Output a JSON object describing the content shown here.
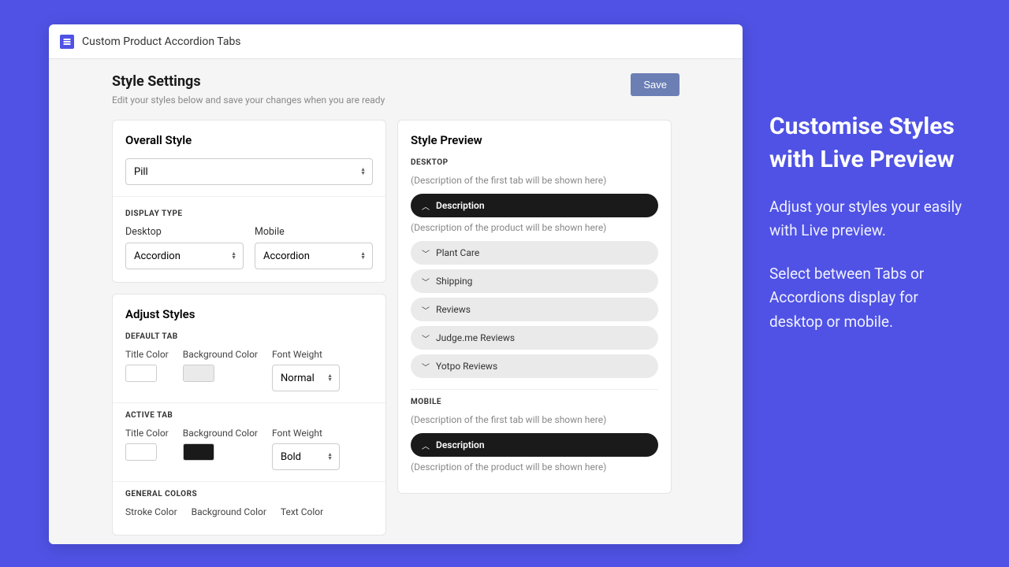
{
  "app": {
    "title": "Custom Product Accordion Tabs"
  },
  "page": {
    "title": "Style Settings",
    "subtitle": "Edit your styles below and save your changes when you are ready",
    "save_label": "Save"
  },
  "overall": {
    "title": "Overall Style",
    "style_value": "Pill",
    "display_type_label": "DISPLAY TYPE",
    "desktop_label": "Desktop",
    "desktop_value": "Accordion",
    "mobile_label": "Mobile",
    "mobile_value": "Accordion"
  },
  "adjust": {
    "title": "Adjust Styles",
    "default_tab_label": "DEFAULT TAB",
    "active_tab_label": "ACTIVE TAB",
    "general_colors_label": "GENERAL COLORS",
    "title_color_label": "Title Color",
    "bg_color_label": "Background Color",
    "font_weight_label": "Font Weight",
    "stroke_color_label": "Stroke Color",
    "text_color_label": "Text Color",
    "default_title_color": "#1a1a1a",
    "default_bg_color": "#eaeaea",
    "default_font_weight": "Normal",
    "active_title_color": "#ffffff",
    "active_bg_color": "#1a1a1a",
    "active_font_weight": "Bold"
  },
  "preview": {
    "title": "Style Preview",
    "desktop_label": "DESKTOP",
    "mobile_label": "MOBILE",
    "first_tab_hint": "(Description of the first tab will be shown here)",
    "product_hint": "(Description of the product will be shown here)",
    "items": [
      {
        "label": "Description",
        "active": true
      },
      {
        "label": "Plant Care",
        "active": false
      },
      {
        "label": "Shipping",
        "active": false
      },
      {
        "label": "Reviews",
        "active": false
      },
      {
        "label": "Judge.me Reviews",
        "active": false
      },
      {
        "label": "Yotpo Reviews",
        "active": false
      }
    ],
    "mobile_items": [
      {
        "label": "Description",
        "active": true
      }
    ]
  },
  "marketing": {
    "heading": "Customise Styles with Live Preview",
    "para1": "Adjust your styles your easily with Live preview.",
    "para2": "Select between Tabs or Accordions display for desktop or mobile."
  }
}
